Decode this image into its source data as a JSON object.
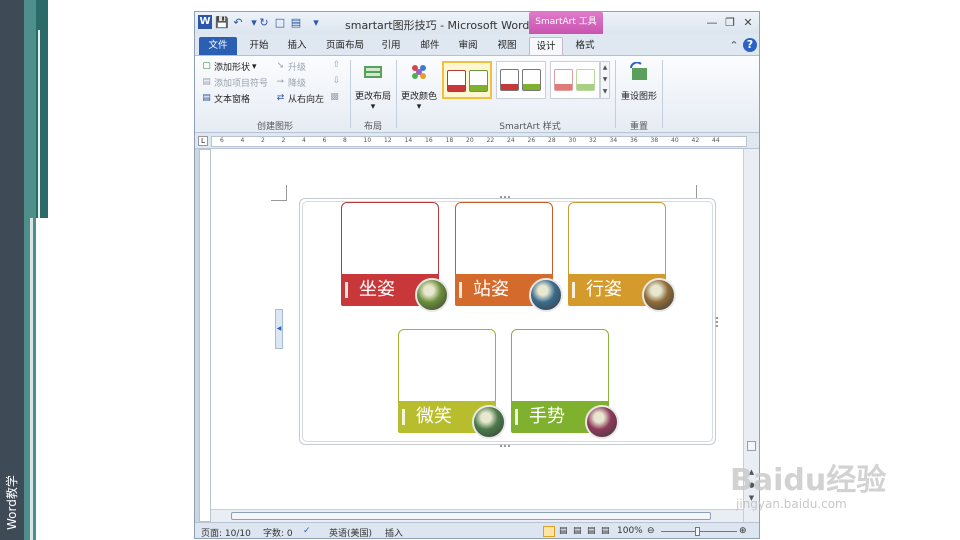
{
  "slide": {
    "side_text": "Word教学"
  },
  "window": {
    "title": "smartart图形技巧 - Microsoft Word",
    "app_icon": "W",
    "context_tab": "SmartArt 工具"
  },
  "tabs": [
    {
      "label": "文件"
    },
    {
      "label": "开始"
    },
    {
      "label": "插入"
    },
    {
      "label": "页面布局"
    },
    {
      "label": "引用"
    },
    {
      "label": "邮件"
    },
    {
      "label": "审阅"
    },
    {
      "label": "视图"
    },
    {
      "label": "设计"
    },
    {
      "label": "格式"
    }
  ],
  "ribbon": {
    "create": {
      "add_shape": "添加形状",
      "add_bullet": "添加项目符号",
      "text_pane": "文本窗格",
      "promote": "升级",
      "demote": "降级",
      "rtl": "从右向左",
      "label": "创建图形"
    },
    "layout": {
      "button": "更改布局",
      "label": "布局"
    },
    "styles": {
      "color_button": "更改颜色",
      "label": "SmartArt 样式"
    },
    "reset": {
      "button": "重设图形",
      "label": "重置"
    }
  },
  "ruler_numbers": [
    "6",
    "4",
    "2",
    "2",
    "4",
    "6",
    "8",
    "10",
    "12",
    "14",
    "16",
    "18",
    "20",
    "22",
    "24",
    "26",
    "28",
    "30",
    "32",
    "34",
    "36",
    "38",
    "40",
    "42",
    "44"
  ],
  "smartart": {
    "cards": [
      {
        "label": "坐姿",
        "color": "#c8383a",
        "border": "#b03a3a"
      },
      {
        "label": "站姿",
        "color": "#d46a2c",
        "border": "#c05f2c"
      },
      {
        "label": "行姿",
        "color": "#d49a2c",
        "border": "#c89a3a"
      },
      {
        "label": "微笑",
        "color": "#b7bd2c",
        "border": "#a8b030"
      },
      {
        "label": "手势",
        "color": "#7fb12e",
        "border": "#8cb040"
      }
    ]
  },
  "status": {
    "page": "页面: 10/10",
    "words": "字数: 0",
    "language": "英语(美国)",
    "mode": "插入",
    "zoom": "100%"
  },
  "watermark": {
    "brand": "Baidu经验",
    "url": "jingyan.baidu.com"
  }
}
